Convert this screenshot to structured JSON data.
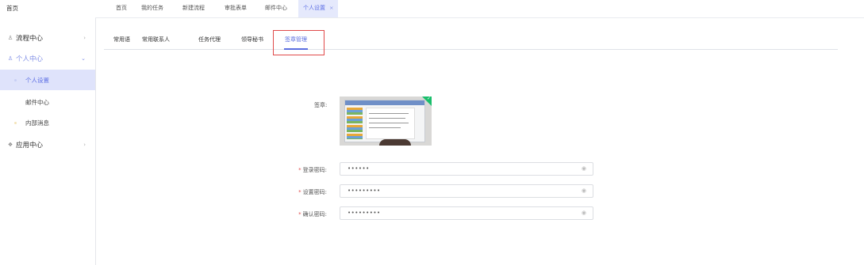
{
  "sidebar": {
    "home": "首页",
    "groups": [
      {
        "icon": "♙",
        "label": "流程中心",
        "arrow": "›"
      },
      {
        "icon": "♙",
        "label": "个人中心",
        "arrow": "⌄"
      },
      {
        "icon": "❖",
        "label": "应用中心",
        "arrow": "›"
      }
    ],
    "subitems": [
      {
        "label": "个人设置"
      },
      {
        "label": "邮件中心"
      },
      {
        "label": "内部消息"
      }
    ]
  },
  "top_tabs": [
    {
      "label": "首页"
    },
    {
      "label": "我的任务"
    },
    {
      "label": "新建流程"
    },
    {
      "label": "审批表单"
    },
    {
      "label": "邮件中心"
    },
    {
      "label": "个人设置",
      "close": "×"
    }
  ],
  "sub_tabs": [
    {
      "label": "常用语"
    },
    {
      "label": "常用联系人"
    },
    {
      "label": "任务代理"
    },
    {
      "label": "领导秘书"
    },
    {
      "label": "签章管理"
    }
  ],
  "signature": {
    "label": "签章:",
    "check": "✓"
  },
  "form": [
    {
      "label": "登录密码:",
      "required": "*",
      "value": "••••••",
      "icon": "◉"
    },
    {
      "label": "设置密码:",
      "required": "*",
      "value": "•••••••••",
      "icon": "◉"
    },
    {
      "label": "确认密码:",
      "required": "*",
      "value": "•••••••••",
      "icon": "◉"
    }
  ],
  "colors": {
    "accent": "#5a6ee0",
    "highlight_box": "#e04a4a",
    "selected_bg": "#dfe3fb"
  }
}
